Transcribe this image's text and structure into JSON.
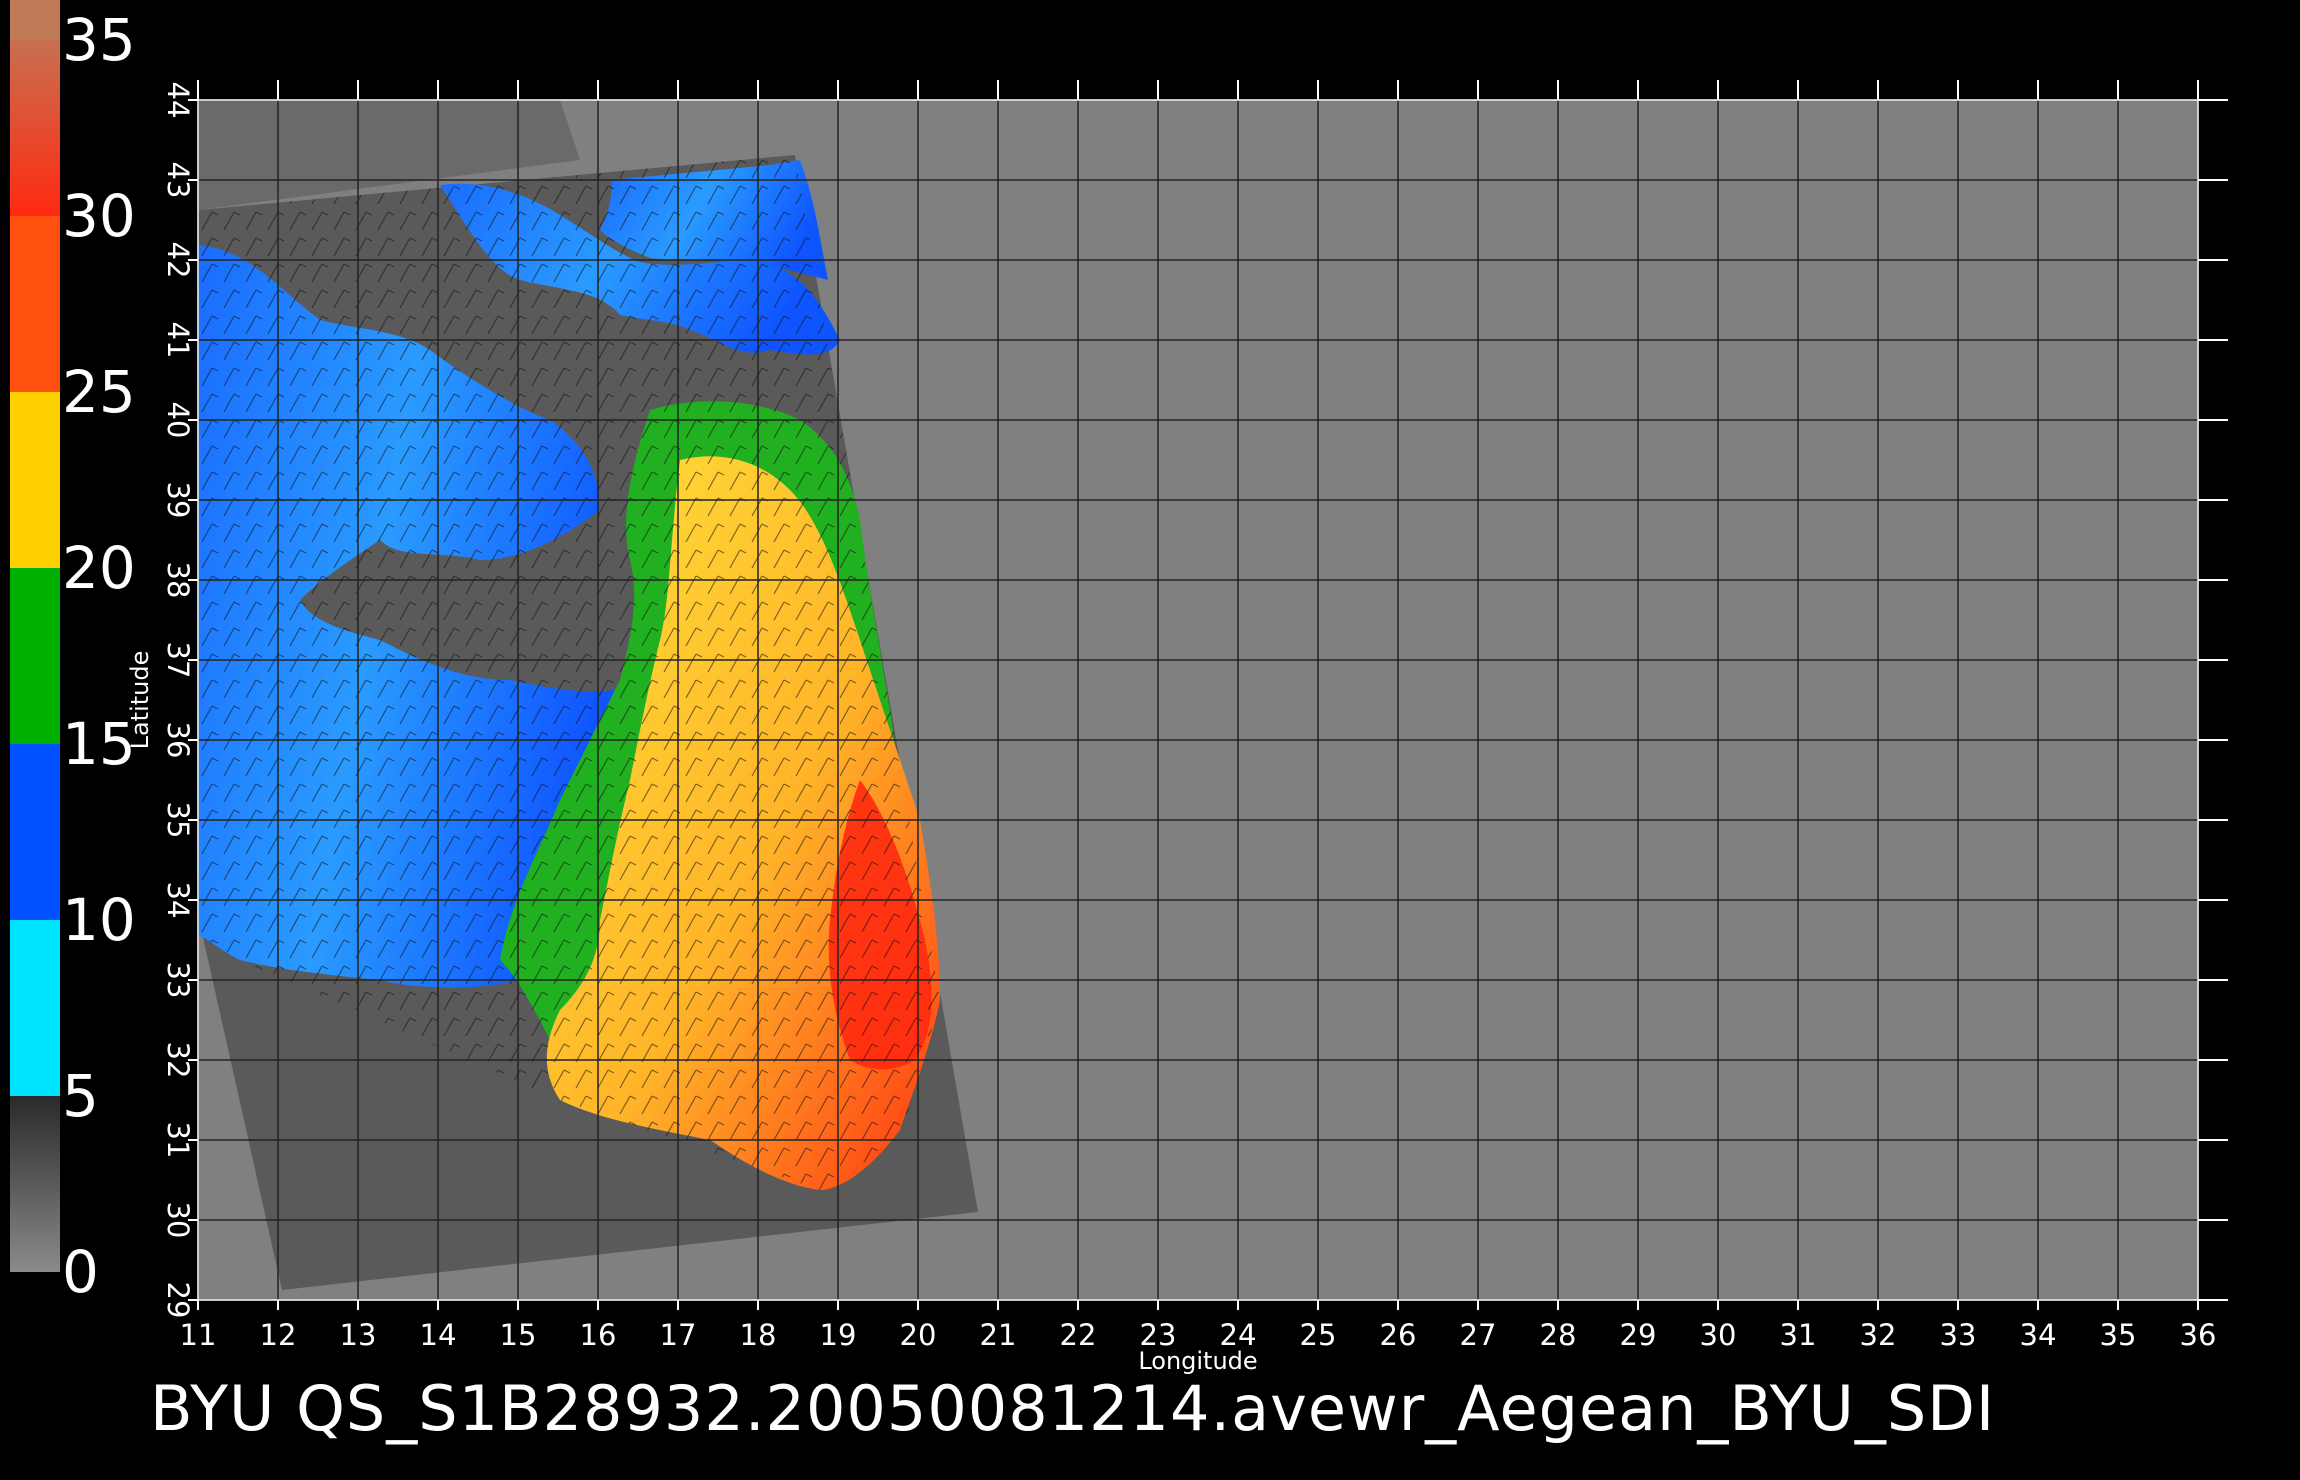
{
  "caption": "BYU  QS_S1B28932.20050081214.avewr_Aegean_BYU_SDI",
  "axes": {
    "xlabel": "Longitude",
    "ylabel": "Latitude",
    "lon_range": [
      11,
      36
    ],
    "lat_range": [
      29,
      44
    ],
    "lon_ticks": [
      "11",
      "12",
      "13",
      "14",
      "15",
      "16",
      "17",
      "18",
      "19",
      "20",
      "21",
      "22",
      "23",
      "24",
      "25",
      "26",
      "27",
      "28",
      "29",
      "30",
      "31",
      "32",
      "33",
      "34",
      "35",
      "36"
    ],
    "lat_ticks": [
      "29",
      "30",
      "31",
      "32",
      "33",
      "34",
      "35",
      "36",
      "37",
      "38",
      "39",
      "40",
      "41",
      "42",
      "43",
      "44"
    ],
    "grid": true
  },
  "colorbar": {
    "ticks": [
      "0",
      "5",
      "10",
      "15",
      "20",
      "25",
      "30",
      "35"
    ],
    "range": [
      0,
      35
    ],
    "segments": [
      {
        "from": 0,
        "to": 5,
        "color": "#606060"
      },
      {
        "from": 5,
        "to": 10,
        "color": "#00e5ff"
      },
      {
        "from": 10,
        "to": 15,
        "color": "#0050ff"
      },
      {
        "from": 15,
        "to": 20,
        "color": "#00b000"
      },
      {
        "from": 20,
        "to": 25,
        "color": "#ffd000"
      },
      {
        "from": 25,
        "to": 30,
        "color": "#ff5010"
      },
      {
        "from": 30,
        "to": 35,
        "color": "#ff1010"
      }
    ]
  },
  "colors": {
    "background": "#000000",
    "land": "#808080",
    "swath_no_data": "#5a5a5a",
    "grid": "#222222"
  }
}
